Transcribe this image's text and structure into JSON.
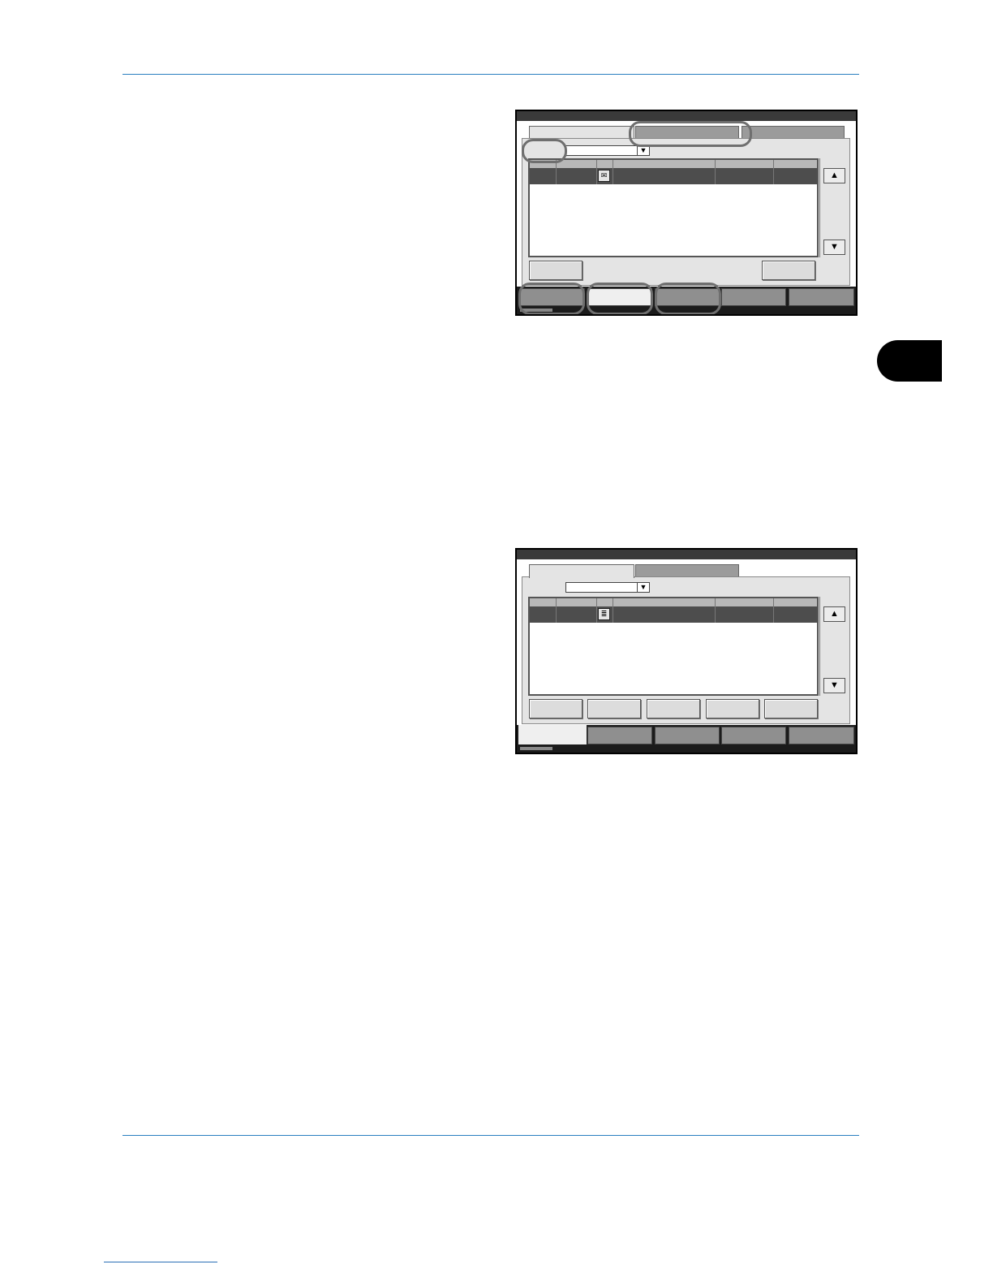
{
  "page": {
    "header_rule": "",
    "footer_rule": ""
  },
  "screens": [
    {
      "name": "document-box-screen-1",
      "icons": {
        "row_icon": "envelope-icon",
        "scroll_up": "arrow-up-icon",
        "scroll_down": "arrow-down-icon"
      },
      "scroll_up_glyph": "▲",
      "scroll_down_glyph": "▼",
      "dropdown_glyph": "▼"
    },
    {
      "name": "document-box-screen-2",
      "icons": {
        "row_icon": "document-list-icon",
        "scroll_up": "arrow-up-icon",
        "scroll_down": "arrow-down-icon"
      },
      "scroll_up_glyph": "▲",
      "scroll_down_glyph": "▼",
      "dropdown_glyph": "▼"
    }
  ]
}
